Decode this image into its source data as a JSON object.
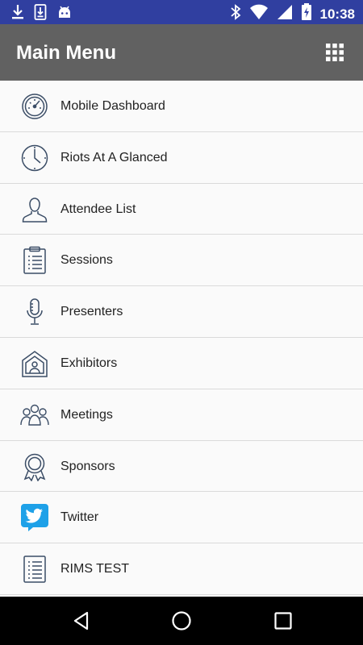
{
  "status_bar": {
    "time": "10:38",
    "left_icons": [
      "download-icon",
      "sd-card-download-icon",
      "android-debug-icon"
    ],
    "right_icons": [
      "bluetooth-icon",
      "wifi-icon",
      "cell-signal-icon",
      "battery-charging-icon"
    ],
    "background": "#303fa0"
  },
  "app_bar": {
    "title": "Main Menu",
    "action_icon": "grid-apps-icon",
    "background": "#616161"
  },
  "menu": {
    "items": [
      {
        "label": "Mobile Dashboard",
        "icon": "speedometer-icon"
      },
      {
        "label": "Riots At A Glanced",
        "icon": "clock-icon"
      },
      {
        "label": "Attendee List",
        "icon": "person-icon"
      },
      {
        "label": "Sessions",
        "icon": "clipboard-list-icon"
      },
      {
        "label": "Presenters",
        "icon": "microphone-icon"
      },
      {
        "label": "Exhibitors",
        "icon": "booth-icon"
      },
      {
        "label": "Meetings",
        "icon": "group-icon"
      },
      {
        "label": "Sponsors",
        "icon": "award-ribbon-icon"
      },
      {
        "label": "Twitter",
        "icon": "twitter-bird-icon"
      },
      {
        "label": "RIMS TEST",
        "icon": "document-list-icon"
      }
    ],
    "icon_color": "#3b4d66",
    "twitter_color": "#1ea1e8"
  },
  "nav_bar": {
    "buttons": [
      "back-icon",
      "home-icon",
      "recents-icon"
    ]
  }
}
